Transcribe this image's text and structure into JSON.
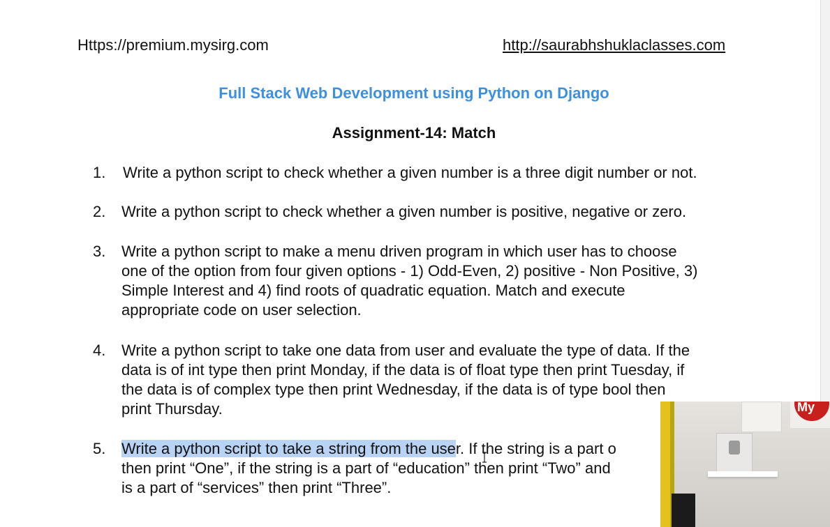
{
  "header": {
    "left_url": "Https://premium.mysirg.com",
    "right_url": "http://saurabhshuklaclasses.com"
  },
  "course_title": "Full Stack Web Development using Python on Django",
  "assignment_title": "Assignment-14: Match",
  "questions": [
    {
      "number": "1.",
      "lines": [
        "Write a python script to check whether a given number is a three digit number or not."
      ]
    },
    {
      "number": "2.",
      "lines": [
        "Write a python script to check whether a given number is positive, negative or zero."
      ]
    },
    {
      "number": "3.",
      "lines": [
        "Write a python script to make a menu driven program in which user has to choose",
        "one of the option from four given options - 1) Odd-Even, 2) positive - Non Positive, 3)",
        "Simple Interest and 4) find roots of quadratic equation. Match and execute",
        "appropriate code on user selection."
      ]
    },
    {
      "number": "4.",
      "lines": [
        "Write a python script to take one data from user and evaluate the type of data. If the",
        "data is of int type then print Monday, if the data is of float type then print Tuesday, if",
        "the data is of complex type then print Wednesday, if the data is of type bool then",
        "print Thursday."
      ]
    },
    {
      "number": "5.",
      "highlighted": "Write a python script to take a string from the use",
      "line1_rest": "r. If the string is a part o",
      "lines": [
        "then print “One”, if the string is a part of “education” then print “Two” and",
        "is a part of “services” then print “Three”."
      ]
    }
  ],
  "webcam": {
    "logo_text": "My",
    "accent_color": "#c8201d"
  }
}
